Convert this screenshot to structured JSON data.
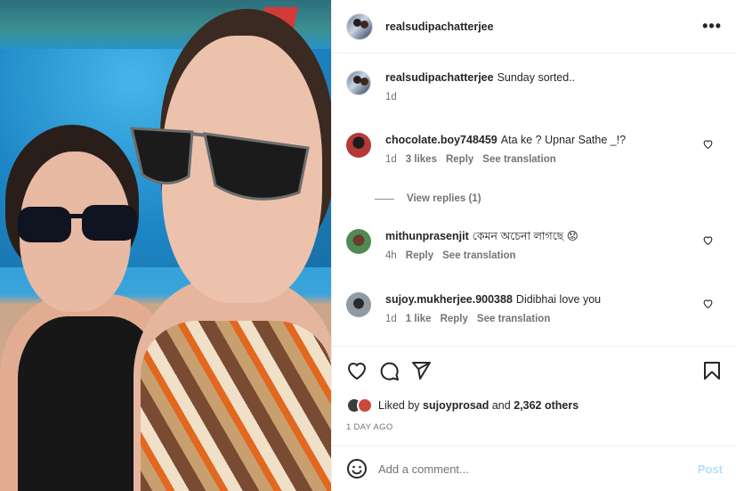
{
  "post": {
    "author": "realsudipachatterjee",
    "caption": "Sunday sorted..",
    "caption_time": "1d"
  },
  "comments": [
    {
      "user": "chocolate.boy748459",
      "text": "Ata ke ? Upnar Sathe _!?",
      "time": "1d",
      "likes": "3 likes",
      "reply": "Reply",
      "translate": "See translation",
      "view_replies": "View replies (1)"
    },
    {
      "user": "mithunprasenjit",
      "text": "কেমন অচেনা লাগছে 😟",
      "time": "4h",
      "reply": "Reply",
      "translate": "See translation"
    },
    {
      "user": "sujoy.mukherjee.900388",
      "text": "Didibhai love you",
      "time": "1d",
      "likes": "1 like",
      "reply": "Reply",
      "translate": "See translation"
    }
  ],
  "likes": {
    "prefix": "Liked by",
    "user": "sujoyprosad",
    "and": "and",
    "others": "2,362 others"
  },
  "date": "1 DAY AGO",
  "add_comment": {
    "placeholder": "Add a comment...",
    "post_label": "Post"
  },
  "icons": {
    "more": "more-options-icon",
    "like": "heart-icon",
    "comment": "comment-icon",
    "share": "share-icon",
    "save": "bookmark-icon",
    "emoji": "emoji-icon"
  },
  "colors": {
    "post_button": "#b2dffc",
    "meta_text": "#737373"
  }
}
